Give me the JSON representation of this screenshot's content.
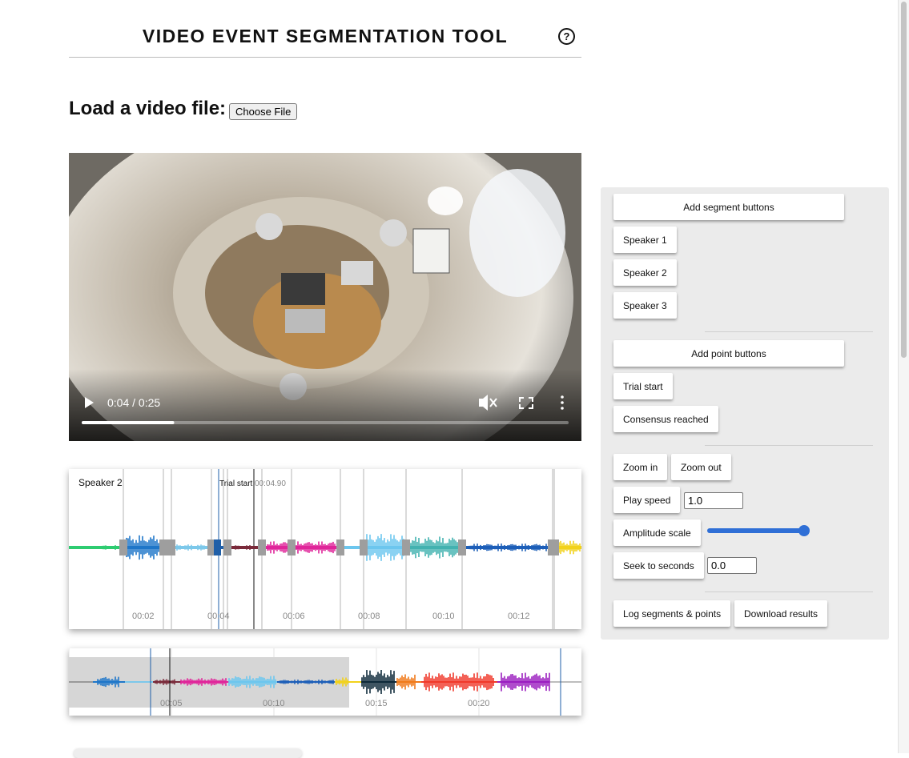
{
  "header": {
    "title": "VIDEO EVENT SEGMENTATION TOOL",
    "help_icon": "?"
  },
  "loader": {
    "label": "Load a video file:",
    "button": "Choose File"
  },
  "video": {
    "time": "0:04 / 0:25",
    "progress": 0.19,
    "muted": true
  },
  "waveform": {
    "segment_label": "Speaker 2",
    "point_label": "Trial start",
    "cursor_time": "00:04.90",
    "ticks": [
      "00:02",
      "00:04",
      "00:06",
      "00:08",
      "00:10",
      "00:12"
    ]
  },
  "overview": {
    "ticks": [
      "00:05",
      "00:10",
      "00:15",
      "00:20"
    ]
  },
  "panel": {
    "add_segment": "Add segment buttons",
    "segments": [
      "Speaker 1",
      "Speaker 2",
      "Speaker 3"
    ],
    "add_point": "Add point buttons",
    "points": [
      "Trial start",
      "Consensus reached"
    ],
    "zoom_in": "Zoom in",
    "zoom_out": "Zoom out",
    "play_speed": "Play speed",
    "play_speed_value": "1.0",
    "amplitude_scale": "Amplitude scale",
    "amplitude_level": 1.0,
    "seek": "Seek to seconds",
    "seek_value": "0.0",
    "log": "Log segments & points",
    "download": "Download results"
  },
  "colors": {
    "green": "#2ecc71",
    "blue": "#1f77c9",
    "light_blue": "#7cc8ea",
    "dark_blue": "#1f5fa8",
    "maroon": "#7a2a3a",
    "magenta": "#e0259a",
    "sky": "#6cc6ee",
    "teal": "#43b3b0",
    "navy": "#1c5fb8",
    "yellow": "#f2d21b",
    "dark": "#0f2a3a",
    "orange": "#f07a1a",
    "red": "#f0392b",
    "purple": "#9b1fc0",
    "accent": "#2f6fd6"
  }
}
